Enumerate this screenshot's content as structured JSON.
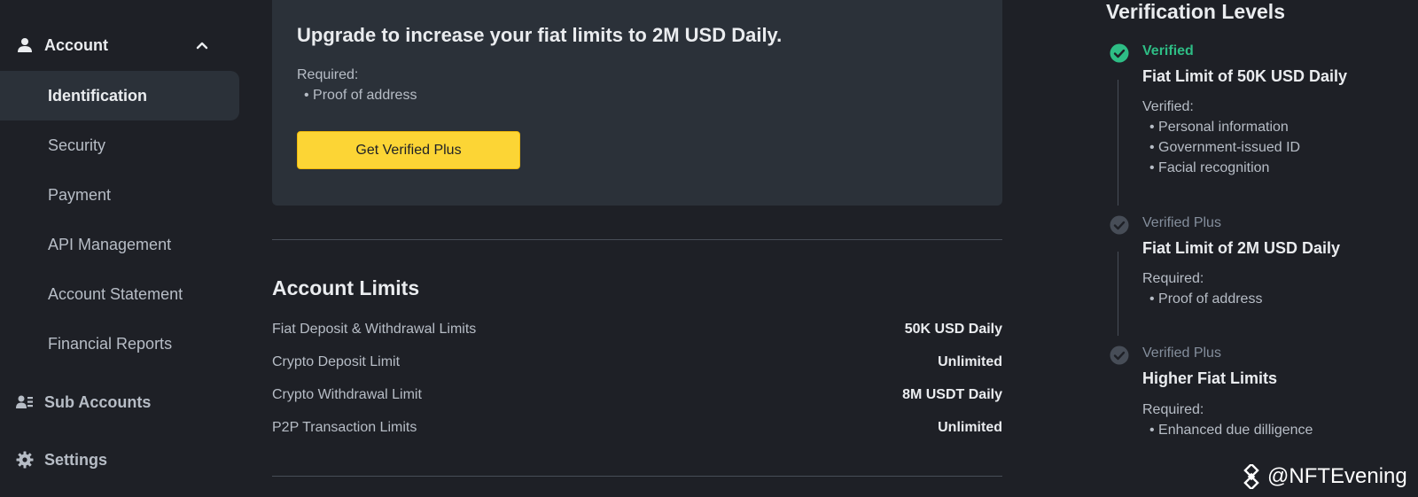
{
  "sidebar": {
    "account": {
      "label": "Account",
      "icon": "user-icon"
    },
    "items": [
      {
        "label": "Identification",
        "selected": true
      },
      {
        "label": "Security"
      },
      {
        "label": "Payment"
      },
      {
        "label": "API Management"
      },
      {
        "label": "Account Statement"
      },
      {
        "label": "Financial Reports"
      }
    ],
    "sub_accounts": {
      "label": "Sub Accounts",
      "icon": "sub-accounts-icon"
    },
    "settings": {
      "label": "Settings",
      "icon": "gear-icon"
    }
  },
  "upgrade": {
    "title": "Upgrade to increase your fiat limits to 2M USD Daily.",
    "required_label": "Required:",
    "required_item": "Proof of address",
    "button_label": "Get Verified Plus"
  },
  "limits": {
    "title": "Account Limits",
    "rows": [
      {
        "label": "Fiat Deposit & Withdrawal Limits",
        "value": "50K USD Daily"
      },
      {
        "label": "Crypto Deposit Limit",
        "value": "Unlimited"
      },
      {
        "label": "Crypto Withdrawal Limit",
        "value": "8M USDT Daily"
      },
      {
        "label": "P2P Transaction Limits",
        "value": "Unlimited"
      }
    ]
  },
  "levels": {
    "title": "Verification Levels",
    "items": [
      {
        "status": "Verified",
        "heading": "Fiat Limit of 50K USD Daily",
        "sub_label": "Verified:",
        "bullets": [
          "Personal information",
          "Government-issued ID",
          "Facial recognition"
        ]
      },
      {
        "status": "Verified Plus",
        "heading": "Fiat Limit of 2M USD Daily",
        "sub_label": "Required:",
        "bullets": [
          "Proof of address"
        ]
      },
      {
        "status": "Verified Plus",
        "heading": "Higher Fiat Limits",
        "sub_label": "Required:",
        "bullets": [
          "Enhanced due dilligence"
        ]
      }
    ]
  },
  "watermark": {
    "text": "@NFTEvening"
  },
  "colors": {
    "background": "#1e2026",
    "panel": "#2b3139",
    "accent_yellow": "#fcd535",
    "success_green": "#2ebd85",
    "muted_text": "#b7bdc6",
    "divider": "#474d57"
  }
}
